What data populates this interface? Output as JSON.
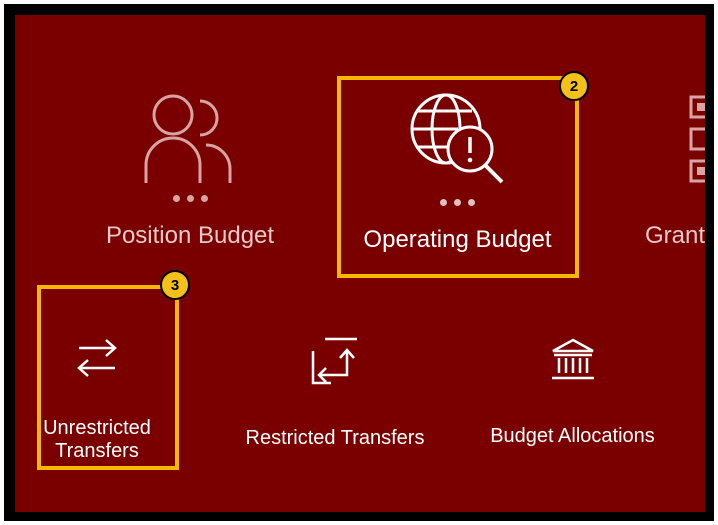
{
  "tiles": {
    "position_budget": {
      "label": "Position Budget",
      "icon": "users-icon"
    },
    "operating_budget": {
      "label": "Operating Budget",
      "icon": "globe-alert-search-icon"
    },
    "grants": {
      "label": "Grants",
      "icon": "grid-checklist-icon"
    },
    "unrestricted_transfers": {
      "label_line1": "Unrestricted",
      "label_line2": "Transfers",
      "icon": "swap-arrows-icon"
    },
    "restricted_transfers": {
      "label": "Restricted Transfers",
      "icon": "restricted-transfer-icon"
    },
    "budget_allocations": {
      "label": "Budget Allocations",
      "icon": "bank-building-icon"
    }
  },
  "callouts": [
    {
      "number": "2",
      "target": "Operating Budget"
    },
    {
      "number": "3",
      "target": "Unrestricted Transfers"
    }
  ],
  "colors": {
    "background": "#7a0000",
    "highlight": "#f5b800",
    "badge": "#f5c01a"
  }
}
